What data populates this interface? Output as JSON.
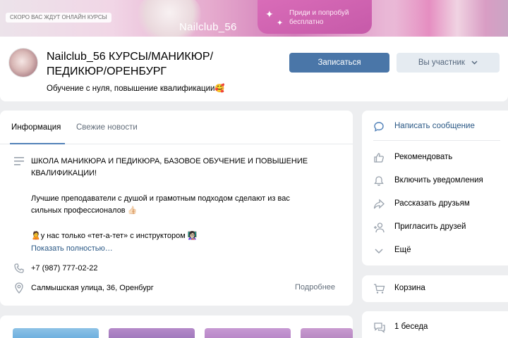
{
  "cover": {
    "tag": "СКОРО ВАС ЖДУТ ОНЛАЙН КУРСЫ",
    "banner_line1": "Приди и попробуй",
    "banner_line2": "бесплатно",
    "brand": "Nailclub_56"
  },
  "header": {
    "name_line1": "Nailclub_56 КУРСЫ/МАНИКЮР/",
    "name_line2": "ПЕДИКЮР/ОРЕНБУРГ",
    "status": "Обучение с нуля, повышение квалификации🥰",
    "join_label": "Записаться",
    "member_label": "Вы участник"
  },
  "tabs": [
    {
      "label": "Информация"
    },
    {
      "label": "Свежие новости"
    }
  ],
  "description": {
    "line1": "ШКОЛА МАНИКЮРА И ПЕДИКЮРА, БАЗОВОЕ ОБУЧЕНИЕ И ПОВЫШЕНИЕ",
    "line2": "КВАЛИФИКАЦИИ!",
    "line3": "Лучшие преподаватели с душой и грамотным подходом сделают из вас",
    "line4": "сильных профессионалов 👍🏻",
    "line5": "🙎у нас только «тет-а-тет» с инструктором 👩🏻‍🏫",
    "more": "Показать полностью…"
  },
  "contacts": {
    "phone": "+7 (987) 777-02-22",
    "address": "Салмышская улица, 36, Оренбург",
    "details": "Подробнее"
  },
  "actions": [
    {
      "label": "Написать сообщение",
      "icon": "message-icon"
    },
    {
      "label": "Рекомендовать",
      "icon": "like-icon"
    },
    {
      "label": "Включить уведомления",
      "icon": "bell-icon"
    },
    {
      "label": "Рассказать друзьям",
      "icon": "share-icon"
    },
    {
      "label": "Пригласить друзей",
      "icon": "add-user-icon"
    },
    {
      "label": "Ещё",
      "icon": "chevron-down-icon"
    }
  ],
  "cart": {
    "label": "Корзина"
  },
  "chat": {
    "label": "1 беседа"
  },
  "colors": {
    "accent": "#4a76a8",
    "link": "#2a5885",
    "background": "#edeef0"
  }
}
